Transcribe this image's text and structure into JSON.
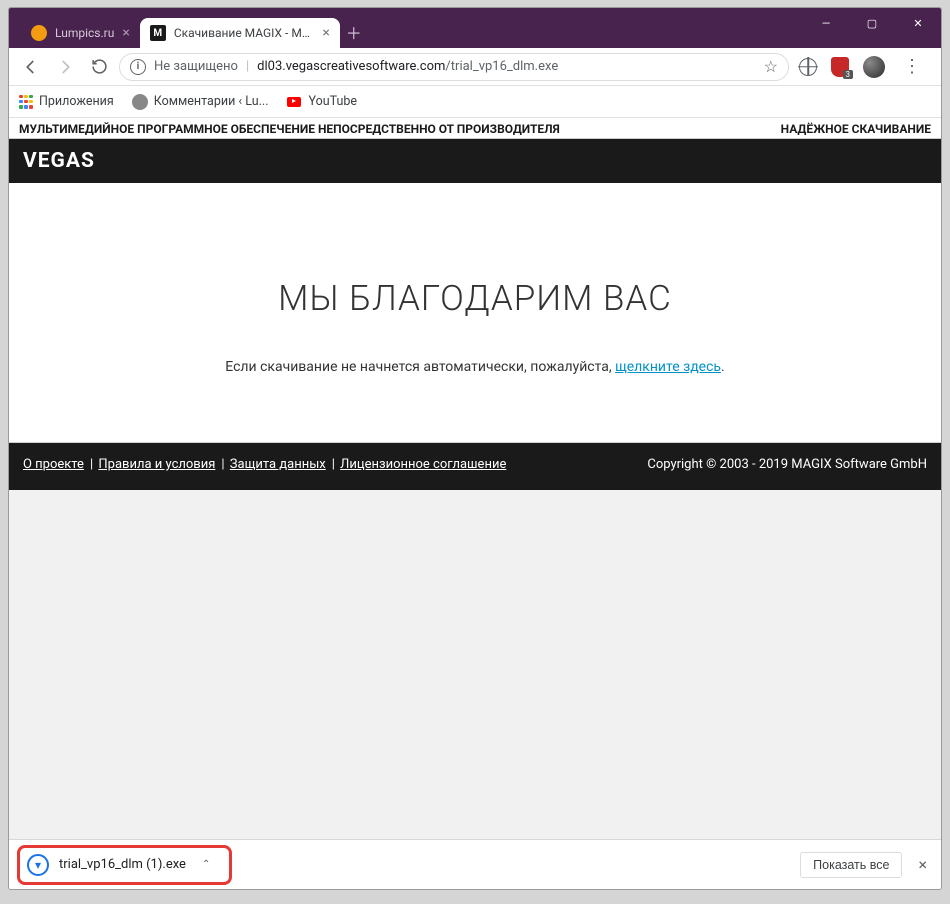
{
  "tabs": [
    {
      "label": "Lumpics.ru"
    },
    {
      "label": "Скачивание MAGIX - Мы благо..."
    }
  ],
  "window_controls": {
    "min": "—",
    "max": "▢",
    "close": "✕"
  },
  "address_bar": {
    "secure_label": "Не защищено",
    "url_host": "dl03.vegascreativesoftware.com",
    "url_path": "/trial_vp16_dlm.exe"
  },
  "ext_shield_badge": "3",
  "bookmarks": {
    "apps": "Приложения",
    "item1": "Комментарии ‹ Lu...",
    "item2": "YouTube"
  },
  "page": {
    "strip_left": "МУЛЬТИМЕДИЙНОЕ ПРОГРАММНОЕ ОБЕСПЕЧЕНИЕ НЕПОСРЕДСТВЕННО ОТ ПРОИЗВОДИТЕЛЯ",
    "strip_right": "НАДЁЖНОЕ СКАЧИВАНИЕ",
    "brand": "VEGAS",
    "title": "МЫ БЛАГОДАРИМ ВАС",
    "sub_prefix": "Если скачивание не начнется автоматически, пожалуйста, ",
    "sub_link": "щелкните здесь",
    "sub_suffix": "."
  },
  "footer": {
    "links": [
      "О проекте",
      "Правила и условия",
      "Защита данных",
      "Лицензионное соглашение"
    ],
    "copyright": "Copyright © 2003 - 2019 MAGIX Software GmbH"
  },
  "download": {
    "filename": "trial_vp16_dlm (1).exe",
    "show_all": "Показать все"
  }
}
